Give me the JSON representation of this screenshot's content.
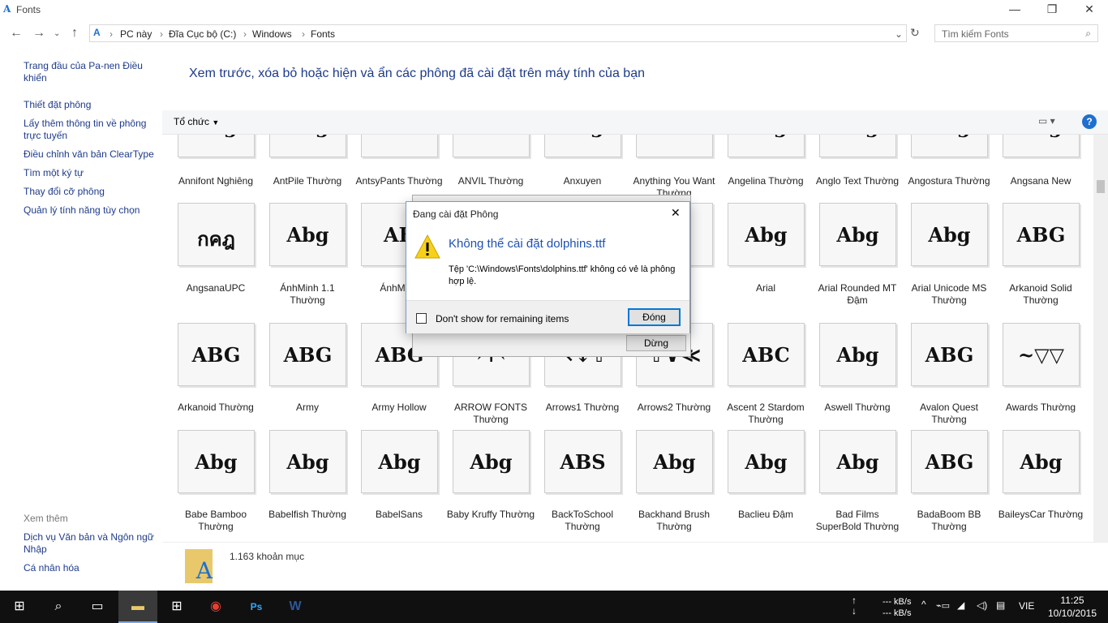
{
  "window": {
    "title": "Fonts",
    "minimize": "—",
    "maximize": "❐",
    "close": "✕"
  },
  "address": {
    "crumbs": [
      "PC này",
      "Đĩa Cục bộ (C:)",
      "Windows",
      "Fonts"
    ],
    "search_placeholder": "Tìm kiếm Fonts"
  },
  "sidebar": {
    "links": [
      "Trang đầu của Pa-nen Điều khiển",
      "Thiết đặt phông",
      "Lấy thêm thông tin về phông trực tuyến",
      "Điều chỉnh văn bản ClearType",
      "Tìm một ký tự",
      "Thay đổi cỡ phông",
      "Quản lý tính năng tùy chọn"
    ],
    "see_also": "Xem thêm",
    "see_also_links": [
      "Dịch vụ Văn bản và Ngôn ngữ Nhập",
      "Cá nhân hóa"
    ]
  },
  "heading": "Xem trước, xóa bỏ hoặc hiện và ẩn các phông đã cài đặt trên máy tính của bạn",
  "toolbar": {
    "organize": "Tổ chức",
    "help": "?"
  },
  "fonts": [
    [
      {
        "n": "Annifont Nghiêng",
        "s": "Abg"
      },
      {
        "n": "AntPile Thường",
        "s": "Abg"
      },
      {
        "n": "AntsyPants Thường",
        "s": "ABG"
      },
      {
        "n": "ANVIL Thường",
        "s": "ABG"
      },
      {
        "n": "Anxuyen",
        "s": "Abg"
      },
      {
        "n": "Anything You Want Thường",
        "s": "ABG"
      },
      {
        "n": "Angelina Thường",
        "s": "Abg"
      },
      {
        "n": "Anglo Text Thường",
        "s": "Abg"
      },
      {
        "n": "Angostura Thường",
        "s": "Abg"
      },
      {
        "n": "Angsana New",
        "s": "Abg"
      }
    ],
    [
      {
        "n": "AngsanaUPC",
        "s": "กคฎ"
      },
      {
        "n": "ÁnhMinh 1.1 Thường",
        "s": "Abg"
      },
      {
        "n": "ÁnhMinh",
        "s": "AB"
      },
      {
        "n": "",
        "s": ""
      },
      {
        "n": "",
        "s": ""
      },
      {
        "n": "",
        "s": ""
      },
      {
        "n": "Arial",
        "s": "Abg"
      },
      {
        "n": "Arial Rounded MT Đậm",
        "s": "Abg"
      },
      {
        "n": "Arial Unicode MS Thường",
        "s": "Abg"
      },
      {
        "n": "Arkanoid Solid Thường",
        "s": "ABG"
      }
    ],
    [
      {
        "n": "Arkanoid Thường",
        "s": "ABG"
      },
      {
        "n": "Army",
        "s": "ABG"
      },
      {
        "n": "Army Hollow",
        "s": "ABG"
      },
      {
        "n": "ARROW FONTS Thường",
        "s": "→↑←"
      },
      {
        "n": "Arrows1 Thường",
        "s": "↖↓⇧"
      },
      {
        "n": "Arrows2 Thường",
        "s": "⇧∨≪"
      },
      {
        "n": "Ascent 2 Stardom Thường",
        "s": "ABC"
      },
      {
        "n": "Aswell Thường",
        "s": "Abg"
      },
      {
        "n": "Avalon Quest Thường",
        "s": "ABG"
      },
      {
        "n": "Awards Thường",
        "s": "~▽▽"
      }
    ],
    [
      {
        "n": "Babe Bamboo Thường",
        "s": "Abg"
      },
      {
        "n": "Babelfish Thường",
        "s": "Abg"
      },
      {
        "n": "BabelSans",
        "s": "Abg"
      },
      {
        "n": "Baby Kruffy Thường",
        "s": "Abg"
      },
      {
        "n": "BackToSchool Thường",
        "s": "ABS"
      },
      {
        "n": "Backhand Brush Thường",
        "s": "Abg"
      },
      {
        "n": "Baclieu Đậm",
        "s": "Abg"
      },
      {
        "n": "Bad Films SuperBold Thường",
        "s": "Abg"
      },
      {
        "n": "BadaBoom BB Thường",
        "s": "ABG"
      },
      {
        "n": "BaileysCar Thường",
        "s": "Abg"
      }
    ]
  ],
  "status": {
    "count": "1.163 khoản mục"
  },
  "dialog": {
    "title": "Đang cài đặt Phông",
    "close": "✕",
    "headline": "Không thể cài đặt dolphins.ttf",
    "message": "Tệp 'C:\\Windows\\Fonts\\dolphins.ttf' không có vẻ là phông hợp lệ.",
    "checkbox": "Don't show for remaining items",
    "ok": "Đóng",
    "stop": "Dừng"
  },
  "taskbar": {
    "net_up": "--- kB/s",
    "net_down": "--- kB/s",
    "lang": "VIE",
    "time": "11:25",
    "date": "10/10/2015"
  },
  "colors": {
    "link": "#1e3b8a",
    "accent": "#0078d7",
    "taskbar": "#101010"
  }
}
